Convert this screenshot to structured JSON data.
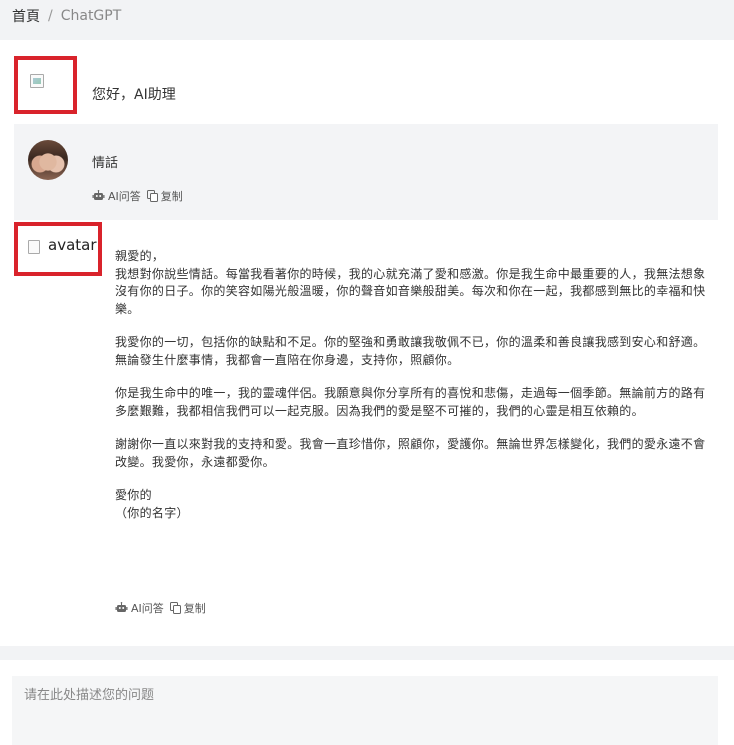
{
  "breadcrumb": {
    "home": "首頁",
    "separator": "/",
    "current": "ChatGPT"
  },
  "welcome": {
    "text": "您好，AI助理"
  },
  "question": {
    "text": "情話",
    "actions": {
      "ai_answer": "AI问答",
      "copy": "复制"
    }
  },
  "answer": {
    "avatar_alt": "avatar",
    "lines": [
      "親愛的，",
      "我想對你說些情話。每當我看著你的時候，我的心就充滿了愛和感激。你是我生命中最重要的人，我無法想象沒有你的日子。你的笑容如陽光般溫暖，你的聲音如音樂般甜美。每次和你在一起，我都感到無比的幸福和快樂。"
    ],
    "paragraphs": [
      "我愛你的一切，包括你的缺點和不足。你的堅強和勇敢讓我敬佩不已，你的溫柔和善良讓我感到安心和舒適。無論發生什麼事情，我都會一直陪在你身邊，支持你，照顧你。",
      "你是我生命中的唯一，我的靈魂伴侶。我願意與你分享所有的喜悅和悲傷，走過每一個季節。無論前方的路有多麼艱難，我都相信我們可以一起克服。因為我們的愛是堅不可摧的，我們的心靈是相互依賴的。",
      "謝謝你一直以來對我的支持和愛。我會一直珍惜你，照顧你，愛護你。無論世界怎樣變化，我們的愛永遠不會改變。我愛你，永遠都愛你。"
    ],
    "closing": "愛你的",
    "signature": "（你的名字）",
    "actions": {
      "ai_answer": "AI问答",
      "copy": "复制"
    }
  },
  "input": {
    "placeholder": "请在此处描述您的问题"
  },
  "colors": {
    "highlight_border": "#d9232b",
    "page_background": "#f2f3f5",
    "question_background": "#f3f4f6"
  }
}
